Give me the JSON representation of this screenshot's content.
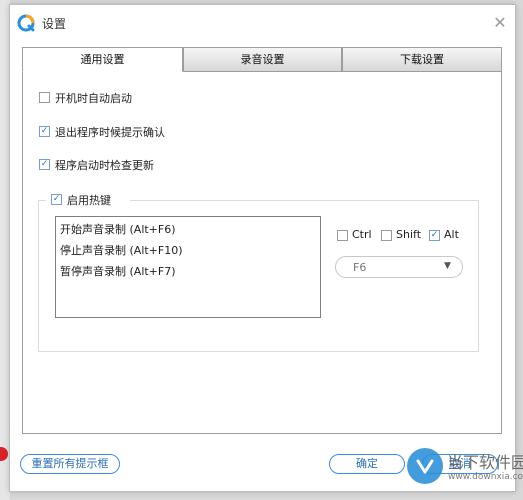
{
  "window": {
    "title": "设置"
  },
  "tabs": [
    {
      "label": "通用设置",
      "active": true
    },
    {
      "label": "录音设置",
      "active": false
    },
    {
      "label": "下载设置",
      "active": false
    }
  ],
  "general": {
    "autostart": {
      "label": "开机时自动启动",
      "checked": false
    },
    "exit_confirm": {
      "label": "退出程序时候提示确认",
      "checked": true
    },
    "check_update": {
      "label": "程序启动时检查更新",
      "checked": true
    }
  },
  "hotkeys": {
    "enable": {
      "label": "启用热键",
      "checked": true
    },
    "items": [
      "开始声音录制 (Alt+F6)",
      "停止声音录制 (Alt+F10)",
      "暂停声音录制 (Alt+F7)"
    ],
    "modifiers": [
      {
        "label": "Ctrl",
        "checked": false
      },
      {
        "label": "Shift",
        "checked": false
      },
      {
        "label": "Alt",
        "checked": true
      }
    ],
    "key": {
      "value": "F6"
    }
  },
  "buttons": {
    "reset": "重置所有提示框",
    "ok": "确定",
    "cancel": "取消"
  },
  "watermark": {
    "line1": "当下软件园",
    "line2": "www.downxia.com"
  },
  "colors": {
    "accent": "#3f8ed8",
    "check_mark": "#2f6fbf"
  }
}
